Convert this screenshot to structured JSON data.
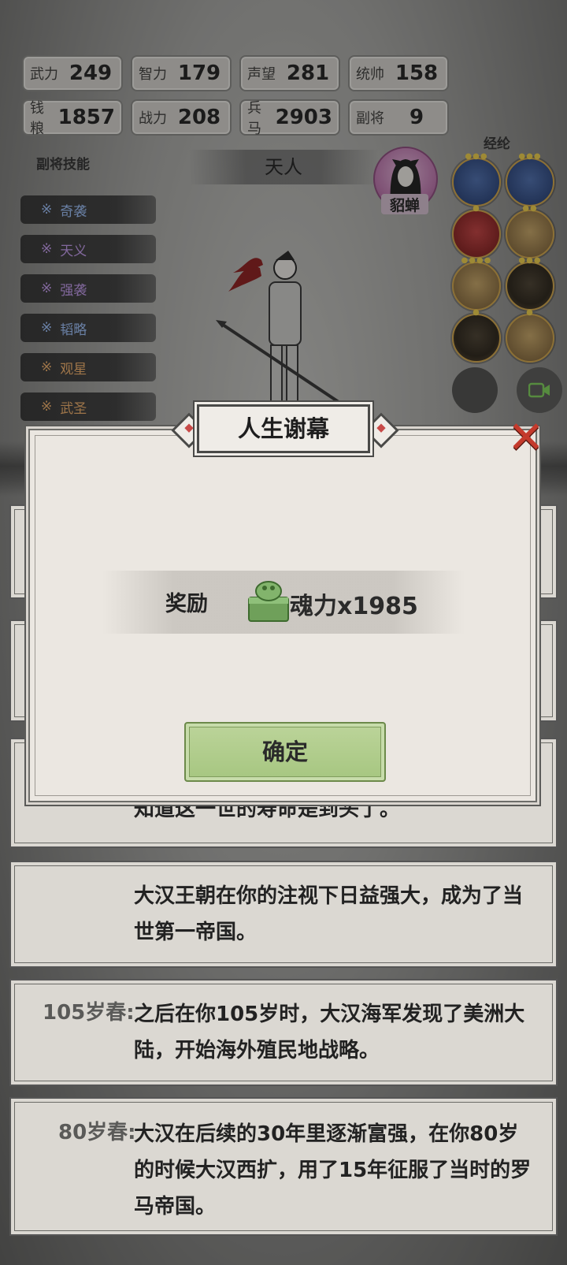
{
  "stats": [
    {
      "label": "武力",
      "value": "249"
    },
    {
      "label": "智力",
      "value": "179"
    },
    {
      "label": "声望",
      "value": "281"
    },
    {
      "label": "统帅",
      "value": "158"
    },
    {
      "label": "钱粮",
      "value": "1857"
    },
    {
      "label": "战力",
      "value": "208"
    },
    {
      "label": "兵马",
      "value": "2903"
    },
    {
      "label": "副将",
      "value": "9"
    }
  ],
  "skills_title": "副将技能",
  "skills": [
    {
      "mark": "※",
      "name": "奇袭",
      "color": "#9fc3ff"
    },
    {
      "mark": "※",
      "name": "天义",
      "color": "#c59cf0"
    },
    {
      "mark": "※",
      "name": "强袭",
      "color": "#c59cf0"
    },
    {
      "mark": "※",
      "name": "韬略",
      "color": "#9fc3ff"
    },
    {
      "mark": "※",
      "name": "观星",
      "color": "#f2b06a"
    },
    {
      "mark": "※",
      "name": "武圣",
      "color": "#f2b06a"
    }
  ],
  "title_banner": "天人",
  "companion_name": "貂蝉",
  "jinglun_title": "经纶",
  "modal": {
    "title": "人生谢幕",
    "reward_label": "奖励",
    "reward_item": "jade-seal-icon",
    "reward_value": "魂力x1985",
    "confirm_label": "确定"
  },
  "log": [
    {
      "age": "",
      "text": "知道这一世的寿命是到头了。"
    },
    {
      "age": "",
      "text": "大汉王朝在你的注视下日益强大，成为了当世第一帝国。"
    },
    {
      "age": "105岁春:",
      "text": "之后在你105岁时，大汉海军发现了美洲大陆，开始海外殖民地战略。"
    },
    {
      "age": "80岁春:",
      "text": "大汉在后续的30年里逐渐富强，在你80岁的时候大汉西扩，用了15年征服了当时的罗马帝国。"
    }
  ],
  "colors": {
    "close": "#c43a2c",
    "confirm": "#a6c680",
    "accent_red": "#c84a48"
  }
}
